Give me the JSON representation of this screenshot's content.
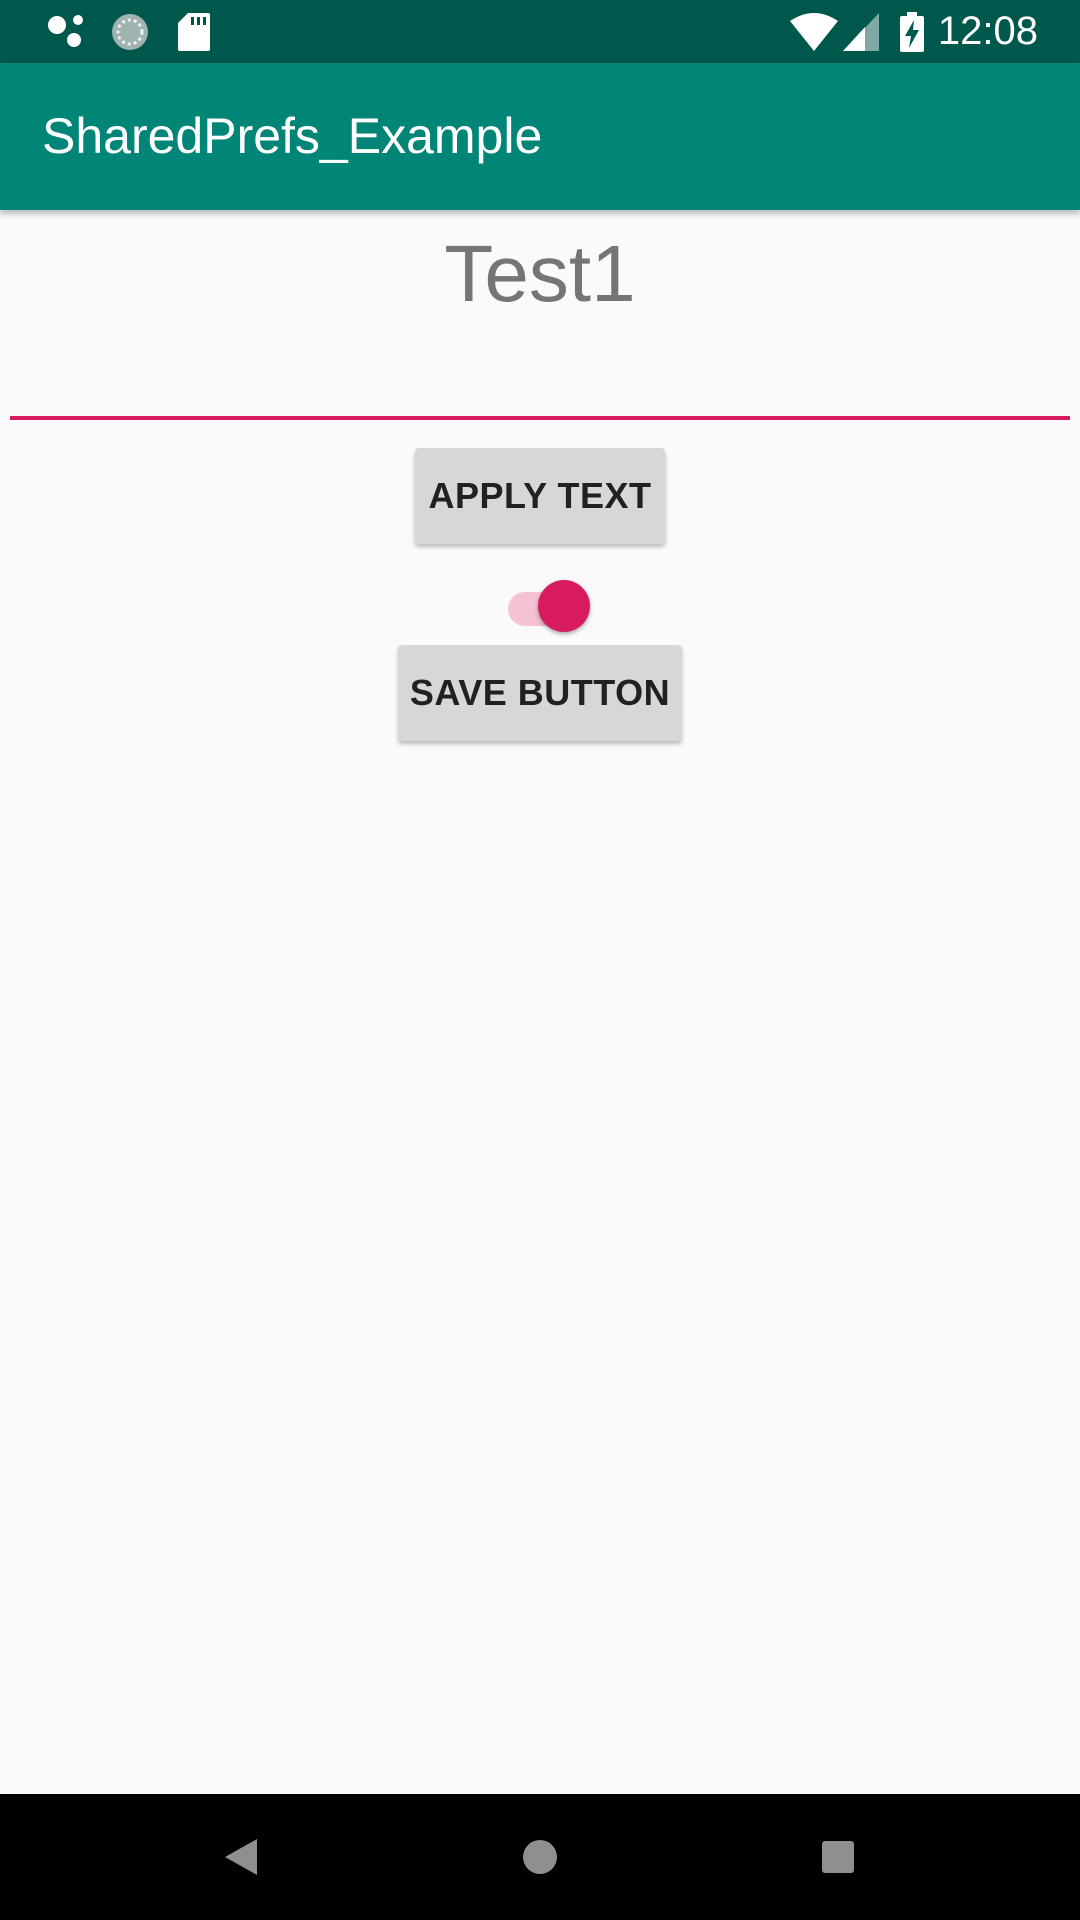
{
  "status_bar": {
    "time": "12:08",
    "icons": [
      "assistant-dots-icon",
      "loading-circle-icon",
      "sd-card-icon",
      "wifi-icon",
      "cell-signal-icon",
      "battery-charging-icon"
    ]
  },
  "app_bar": {
    "title": "SharedPrefs_Example"
  },
  "main": {
    "display_text": "Test1",
    "input_value": "",
    "apply_button_label": "APPLY TEXT",
    "switch_on": true,
    "save_button_label": "SAVE BUTTON"
  },
  "nav_bar": {
    "icons": [
      "back-icon",
      "home-icon",
      "recents-icon"
    ]
  },
  "colors": {
    "status_bar": "#00574b",
    "app_bar": "#008577",
    "accent": "#d81b60",
    "accent_light": "#f4c2d4",
    "button_bg": "#d6d7d7",
    "background": "#fafafa"
  }
}
